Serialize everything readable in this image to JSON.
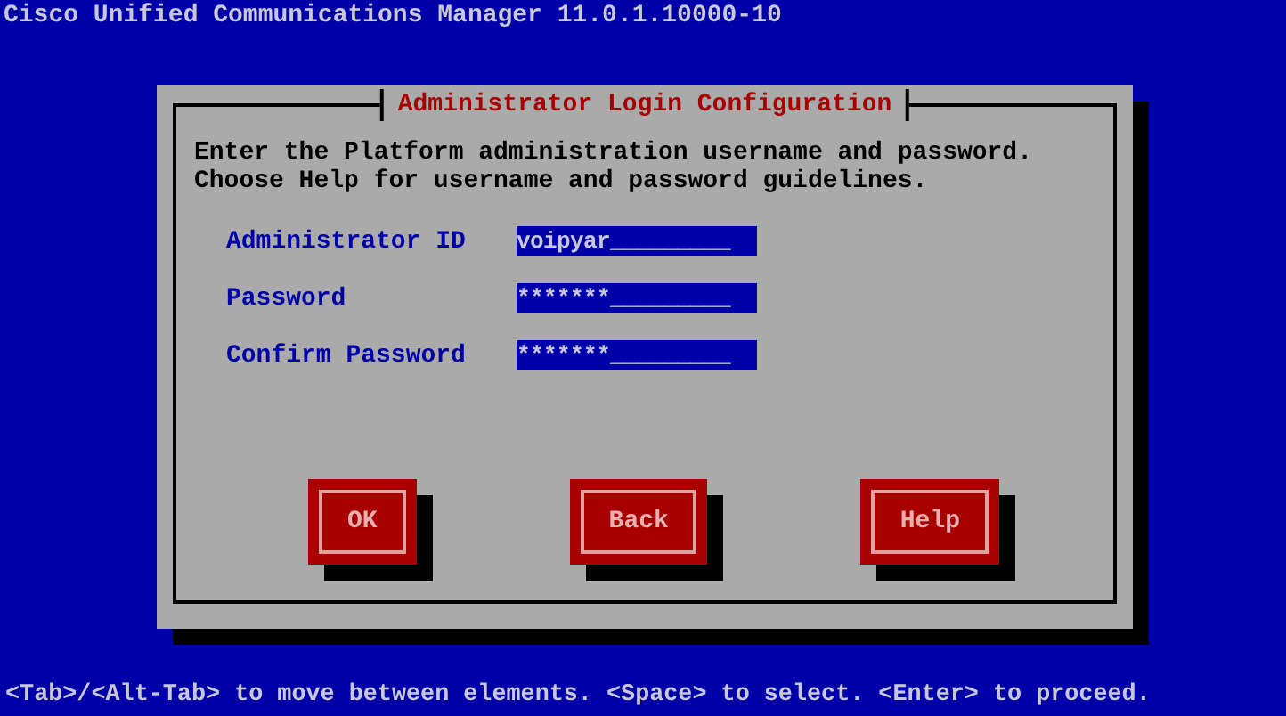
{
  "window": {
    "title": "Cisco Unified Communications Manager 11.0.1.10000-10"
  },
  "dialog": {
    "title": "Administrator Login Configuration",
    "instructions": [
      "Enter the Platform administration username and password.",
      "Choose Help for username and password guidelines."
    ],
    "fields": [
      {
        "label": "Administrator ID",
        "value": "voipyar_________"
      },
      {
        "label": "Password",
        "value": "*******_________"
      },
      {
        "label": "Confirm Password",
        "value": "*******_________"
      }
    ],
    "buttons": [
      {
        "label": "OK"
      },
      {
        "label": "Back"
      },
      {
        "label": "Help"
      }
    ]
  },
  "status_bar": "<Tab>/<Alt-Tab> to move between elements. <Space> to select. <Enter> to proceed."
}
